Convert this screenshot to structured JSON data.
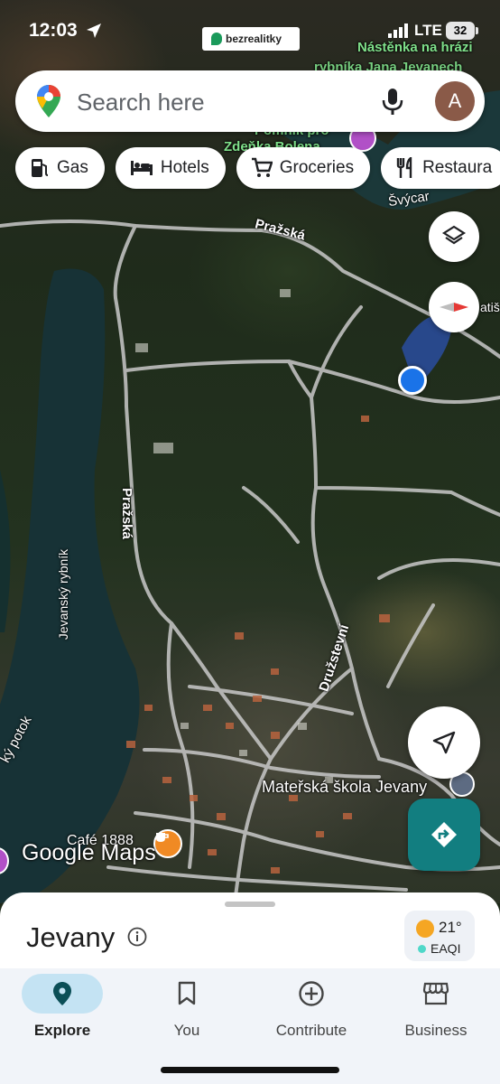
{
  "status_bar": {
    "time": "12:03",
    "network": "LTE",
    "battery": "32"
  },
  "ad_badge": {
    "label": "bezrealitky"
  },
  "search": {
    "placeholder": "Search here",
    "avatar_letter": "A"
  },
  "chips": [
    {
      "icon": "gas-station-icon",
      "label": "Gas"
    },
    {
      "icon": "bed-icon",
      "label": "Hotels"
    },
    {
      "icon": "cart-icon",
      "label": "Groceries"
    },
    {
      "icon": "fork-knife-icon",
      "label": "Restaura"
    }
  ],
  "map": {
    "labels": {
      "nastenka": "Nástěnka na hrázi",
      "nastenka2": "rybníka Jana Jevanech",
      "pomnik": "Pomník pro",
      "zdenka": "Zdeňka Bolena",
      "svycar": "Švýcar",
      "prazska_top": "Pražská",
      "prazska_vert": "Pražská",
      "rybnik": "Jevanský rybník",
      "potok": "ký potok",
      "druzstevni": "Družstevní",
      "skola": "Mateřská škola Jevany",
      "cafe": "Café 1888",
      "edge": "atiš"
    },
    "logo": "Google Maps"
  },
  "place": {
    "name": "Jevany",
    "weather_temp": "21°",
    "weather_aq": "EAQI"
  },
  "nav": [
    {
      "label": "Explore",
      "active": true
    },
    {
      "label": "You",
      "active": false
    },
    {
      "label": "Contribute",
      "active": false
    },
    {
      "label": "Business",
      "active": false
    }
  ],
  "colors": {
    "accent_teal": "#127e80",
    "user_location": "#1a73e8",
    "explore_pill": "#c4e3f3"
  }
}
